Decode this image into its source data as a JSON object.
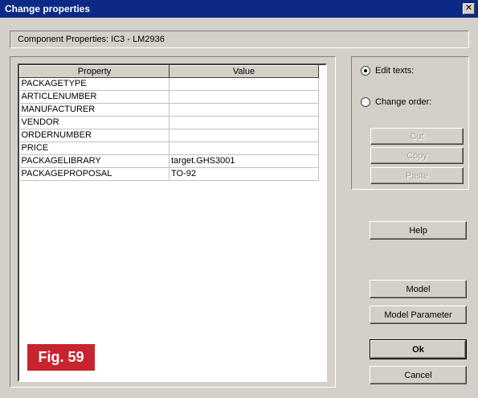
{
  "window": {
    "title": "Change properties",
    "close_glyph": "✕"
  },
  "header": {
    "text": "Component Properties: IC3 - LM2936"
  },
  "table": {
    "columns": [
      "Property",
      "Value"
    ],
    "rows": [
      [
        "PACKAGETYPE",
        ""
      ],
      [
        "ARTICLENUMBER",
        ""
      ],
      [
        "MANUFACTURER",
        ""
      ],
      [
        "VENDOR",
        ""
      ],
      [
        "ORDERNUMBER",
        ""
      ],
      [
        "PRICE",
        ""
      ],
      [
        "PACKAGELIBRARY",
        "target.GHS3001"
      ],
      [
        "PACKAGEPROPOSAL",
        "TO-92"
      ]
    ]
  },
  "options": {
    "edit_texts": "Edit texts:",
    "change_order": "Change order:",
    "selected": "edit_texts"
  },
  "buttons": {
    "cut": "Cut",
    "copy": "Copy",
    "paste": "Paste",
    "help": "Help",
    "model": "Model",
    "model_parameter": "Model Parameter",
    "ok": "Ok",
    "cancel": "Cancel"
  },
  "figure": {
    "label": "Fig. 59"
  },
  "colors": {
    "figure_badge": "#c8242f",
    "titlebar": "#0b2a86",
    "dialog": "#d4d0c8"
  }
}
